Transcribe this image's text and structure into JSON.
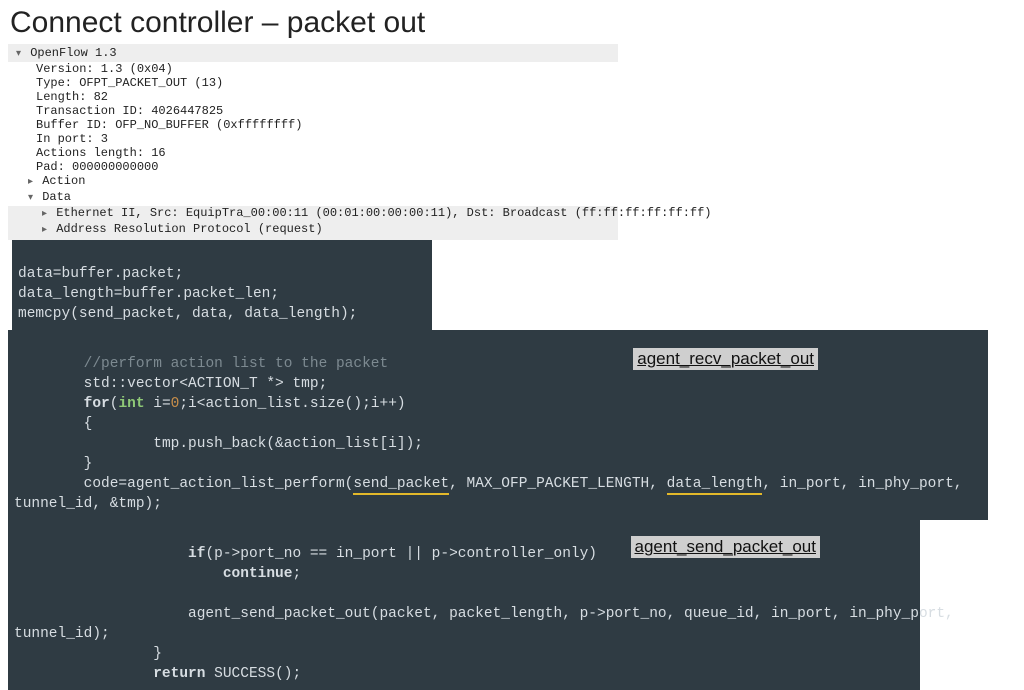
{
  "title": "Connect controller – packet out",
  "pkt": {
    "proto": "OpenFlow 1.3",
    "fields": [
      "Version: 1.3 (0x04)",
      "Type: OFPT_PACKET_OUT (13)",
      "Length: 82",
      "Transaction ID: 4026447825",
      "Buffer ID: OFP_NO_BUFFER (0xffffffff)",
      "In port: 3",
      "Actions length: 16",
      "Pad: 000000000000"
    ],
    "action": "Action",
    "data": "Data",
    "data_children": [
      "Ethernet II, Src: EquipTra_00:00:11 (00:01:00:00:00:11), Dst: Broadcast (ff:ff:ff:ff:ff:ff)",
      "Address Resolution Protocol (request)"
    ]
  },
  "code1": {
    "l1": "data=buffer.packet;",
    "l2": "data_length=buffer.packet_len;",
    "l3": "memcpy(send_packet, data, data_length);"
  },
  "code2": {
    "badge": "agent_recv_packet_out",
    "comment": "//perform action list to the packet",
    "l2": "std::vector<ACTION_T *> tmp;",
    "for_kw": "for",
    "for_int": "int",
    "for_init": " i=",
    "zero": "0",
    "for_rest": ";i<action_list.size();i++)",
    "l4": "{",
    "l5": "        tmp.push_back(&action_list[i]);",
    "l6": "}",
    "call_a": "code=agent_action_list_perform(",
    "send_packet": "send_packet",
    "call_b": ", MAX_OFP_PACKET_LENGTH, ",
    "data_length": "data_length",
    "call_c": ", in_port, in_phy_port,",
    "cont": "tunnel_id, &tmp);"
  },
  "code3": {
    "badge": "agent_send_packet_out",
    "if_kw": "if",
    "if_cond": "(p->port_no == in_port || p->controller_only)",
    "cont_kw": "continue",
    "semi": ";",
    "call_a": "agent_send_packet_out(packet, packet_length, p->port_no, queue_id, in_port, in_phy_port,",
    "call_b": "tunnel_id);",
    "brace": "}",
    "ret_kw": "return",
    "ret_rest": " SUCCESS();"
  }
}
